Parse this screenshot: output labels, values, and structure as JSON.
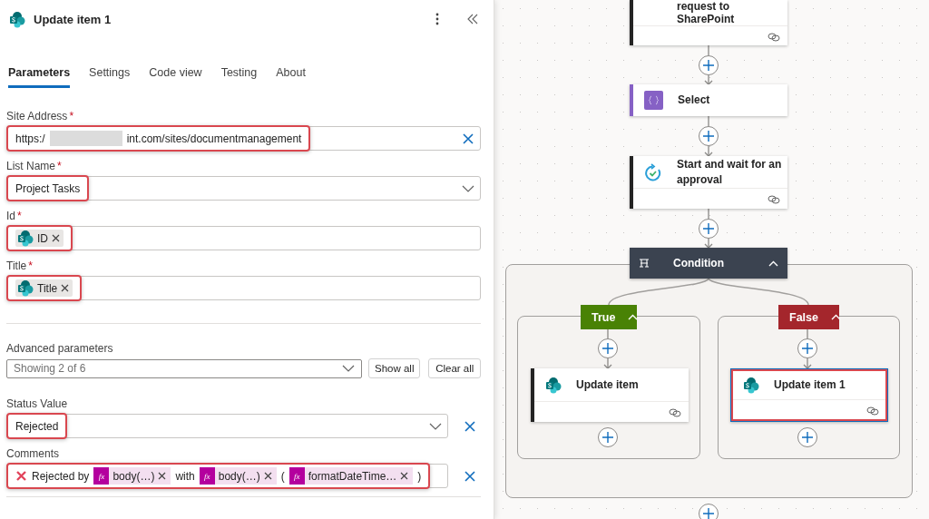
{
  "panel": {
    "title": "Update item 1",
    "tabs": [
      {
        "label": "Parameters",
        "selected": true
      },
      {
        "label": "Settings",
        "selected": false
      },
      {
        "label": "Code view",
        "selected": false
      },
      {
        "label": "Testing",
        "selected": false
      },
      {
        "label": "About",
        "selected": false
      }
    ],
    "fields": [
      {
        "kind": "text",
        "label": "Site Address",
        "required_mark": "*",
        "highlighted": true,
        "clearable": true,
        "value_parts": [
          "https:/",
          "int.com/sites/documentmanagement"
        ]
      },
      {
        "kind": "dropdown",
        "label": "List Name",
        "required_mark": "*",
        "highlighted": true,
        "value": "Project Tasks"
      },
      {
        "kind": "tokens",
        "label": "Id",
        "required_mark": "*",
        "highlighted": true,
        "parts": [
          {
            "kind": "sharepoint",
            "text": "ID"
          }
        ]
      },
      {
        "kind": "tokens",
        "label": "Title",
        "required_mark": "*",
        "highlighted": true,
        "parts": [
          {
            "kind": "sharepoint",
            "text": "Title"
          }
        ]
      }
    ],
    "advanced": {
      "label": "Advanced parameters",
      "placeholder": "Showing 2 of 6",
      "buttons": [
        "Show all",
        "Clear all"
      ]
    },
    "advanced_fields": [
      {
        "kind": "dropdown",
        "label": "Status Value",
        "highlighted": true,
        "removable": true,
        "value": "Rejected"
      },
      {
        "kind": "tokens",
        "label": "Comments",
        "highlighted": true,
        "removable": true,
        "parts": [
          {
            "kind": "icon"
          },
          {
            "kind": "text",
            "text": "Rejected by"
          },
          {
            "kind": "expression",
            "badge": "fx",
            "text": "body(…)"
          },
          {
            "kind": "text",
            "text": "with"
          },
          {
            "kind": "expression",
            "badge": "fx",
            "text": "body(…)"
          },
          {
            "kind": "text",
            "text": "("
          },
          {
            "kind": "expression",
            "badge": "fx",
            "text": "formatDateTime…"
          },
          {
            "kind": "text",
            "text": ")"
          }
        ]
      }
    ]
  },
  "canvas": {
    "nodes": [
      {
        "kind": "request",
        "title": "request to SharePoint"
      },
      {
        "kind": "select",
        "title": "Select"
      },
      {
        "kind": "approval",
        "title": "Start and wait for an approval"
      }
    ],
    "condition": {
      "title": "Condition",
      "expanded": true,
      "branches": [
        {
          "label": "True",
          "expanded": true,
          "color": "#498205",
          "actions": [
            {
              "kind": "sharepoint",
              "title": "Update item",
              "selected": false,
              "highlighted": false
            }
          ]
        },
        {
          "label": "False",
          "expanded": true,
          "color": "#a4262c",
          "actions": [
            {
              "kind": "sharepoint",
              "title": "Update item 1",
              "selected": true,
              "highlighted": true
            }
          ]
        }
      ]
    }
  }
}
